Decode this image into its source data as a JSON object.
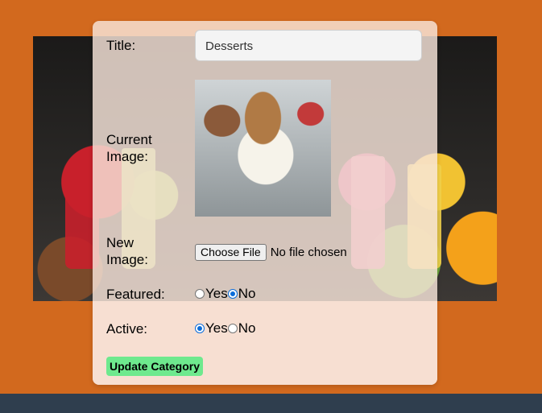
{
  "form": {
    "title_label": "Title:",
    "title_value": "Desserts",
    "current_image_label_1": "Current",
    "current_image_label_2": "Image:",
    "new_image_label_1": "New",
    "new_image_label_2": "Image:",
    "choose_file_label": "Choose File",
    "file_status": "No file chosen",
    "featured_label": "Featured:",
    "featured_options": [
      "Yes",
      "No"
    ],
    "featured_selected": "No",
    "active_label": "Active:",
    "active_options": [
      "Yes",
      "No"
    ],
    "active_selected": "Yes",
    "submit_label": "Update Category"
  },
  "colors": {
    "page_background": "#d2691e",
    "card_background": "#f8e5da",
    "submit_button": "#6ee98e",
    "footer": "#2f3e4e",
    "radio_checked": "#0b6cd9"
  }
}
